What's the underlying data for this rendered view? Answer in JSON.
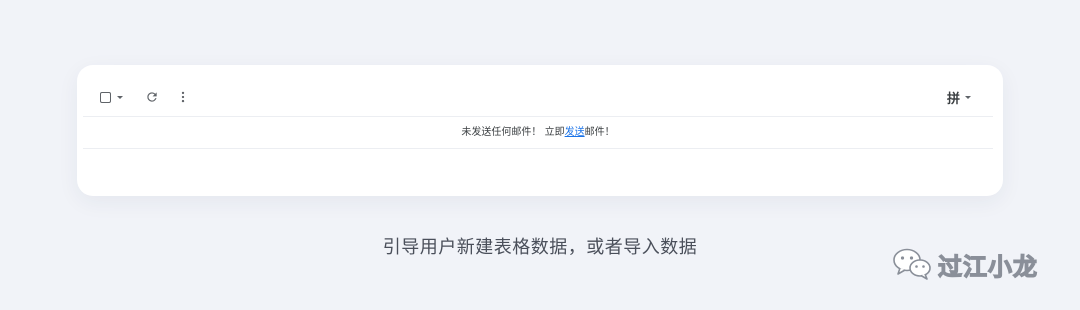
{
  "toolbar": {
    "select_icon": "checkbox-icon",
    "select_dropdown_icon": "caret-down-icon",
    "refresh_icon": "refresh-icon",
    "more_icon": "more-vertical-icon",
    "input_method_label": "拼",
    "input_method_dropdown_icon": "caret-down-icon"
  },
  "empty_state": {
    "message": "未发送任何邮件！ 立即",
    "link_text": "发送",
    "suffix": "邮件！"
  },
  "caption": "引导用户新建表格数据，或者导入数据",
  "watermark": {
    "icon": "wechat-icon",
    "text": "过江小龙"
  },
  "colors": {
    "background": "#f1f3f8",
    "card": "#ffffff",
    "link": "#1a73e8",
    "icon": "#5f6368"
  }
}
